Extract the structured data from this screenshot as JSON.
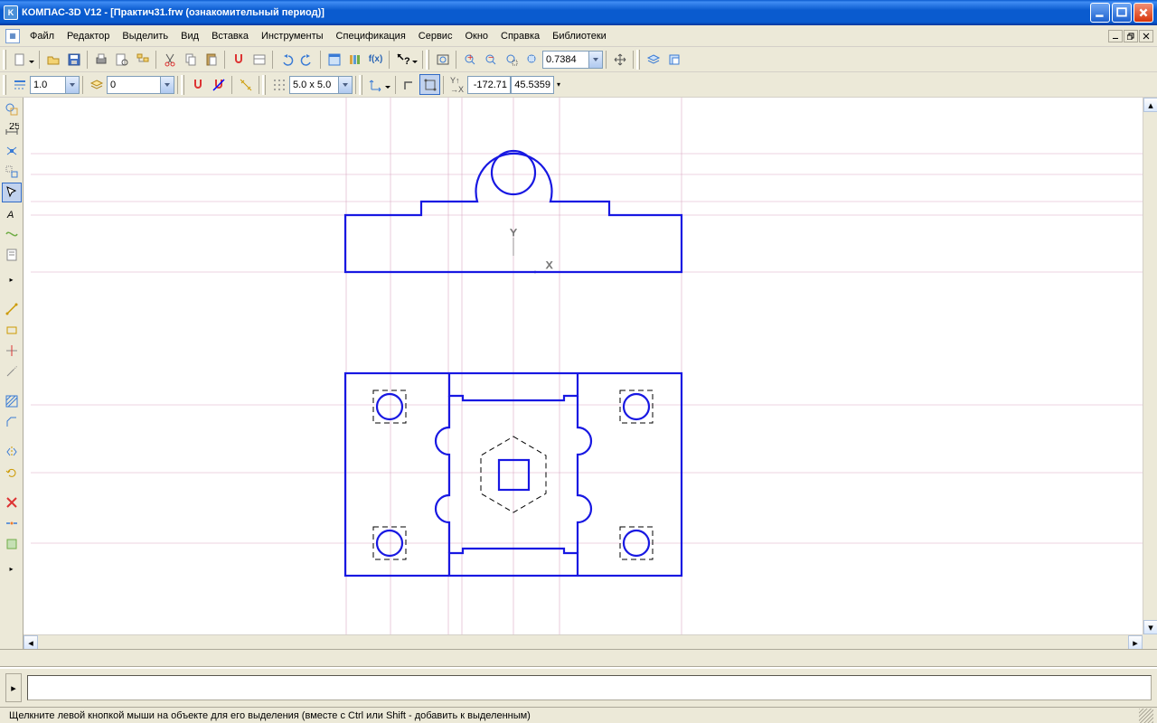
{
  "title": "КОМПАС-3D V12 - [Практич31.frw (ознакомительный период)]",
  "menus": [
    "Файл",
    "Редактор",
    "Выделить",
    "Вид",
    "Вставка",
    "Инструменты",
    "Спецификация",
    "Сервис",
    "Окно",
    "Справка",
    "Библиотеки"
  ],
  "toolbar2": {
    "line_width": "1.0",
    "layer": "0",
    "grid": "5.0 x 5.0",
    "coord_x": "-172.71",
    "coord_y": "45.5359"
  },
  "zoom": "0.7384",
  "status": "Щелкните левой кнопкой мыши на объекте для его выделения (вместе с Ctrl или Shift - добавить к выделенным)"
}
